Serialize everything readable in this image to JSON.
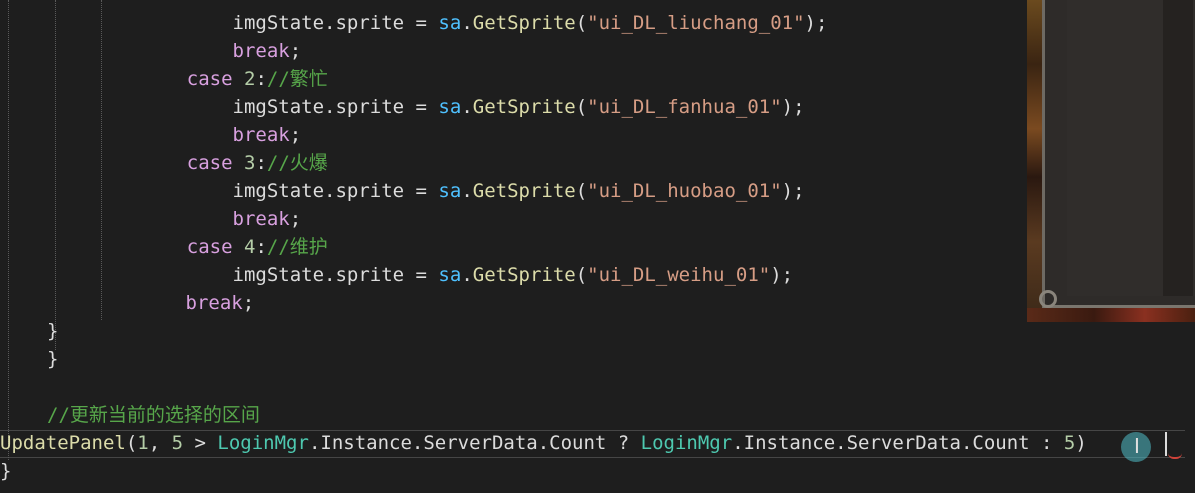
{
  "colors": {
    "background": "#1e1e1e",
    "keyword": "#569cd6",
    "control_keyword": "#d8a0df",
    "number": "#b5cea8",
    "string": "#d69d85",
    "comment": "#57a64a",
    "class_name": "#4ec9b0",
    "method": "#dcdcaa",
    "variable": "#9cdcfe",
    "plain": "#dcdcdc"
  },
  "icons": {
    "cursor": "cursor-ibeam-icon",
    "caret": "caret-icon",
    "error_squiggle": "squiggle-icon"
  },
  "code": {
    "lines": [
      {
        "tokens": [
          {
            "text": "        imgState",
            "type": "pln"
          },
          {
            "text": ".sprite = ",
            "type": "pln"
          },
          {
            "text": "sa",
            "type": "sa"
          },
          {
            "text": ".",
            "type": "pln"
          },
          {
            "text": "GetSprite",
            "type": "mtd"
          },
          {
            "text": "(",
            "type": "pln"
          },
          {
            "text": "\"ui_DL_liuchang_01\"",
            "type": "str"
          },
          {
            "text": ");",
            "type": "pln"
          }
        ]
      },
      {
        "tokens": [
          {
            "text": "        ",
            "type": "pln"
          },
          {
            "text": "break",
            "type": "ctl"
          },
          {
            "text": ";",
            "type": "pln"
          }
        ]
      },
      {
        "tokens": [
          {
            "text": "    ",
            "type": "pln"
          },
          {
            "text": "case",
            "type": "ctl"
          },
          {
            "text": " ",
            "type": "pln"
          },
          {
            "text": "2",
            "type": "num"
          },
          {
            "text": ":",
            "type": "pln"
          },
          {
            "text": "//繁忙",
            "type": "cmt"
          }
        ]
      },
      {
        "tokens": [
          {
            "text": "        imgState",
            "type": "pln"
          },
          {
            "text": ".sprite = ",
            "type": "pln"
          },
          {
            "text": "sa",
            "type": "sa"
          },
          {
            "text": ".",
            "type": "pln"
          },
          {
            "text": "GetSprite",
            "type": "mtd"
          },
          {
            "text": "(",
            "type": "pln"
          },
          {
            "text": "\"ui_DL_fanhua_01\"",
            "type": "str"
          },
          {
            "text": ");",
            "type": "pln"
          }
        ]
      },
      {
        "tokens": [
          {
            "text": "        ",
            "type": "pln"
          },
          {
            "text": "break",
            "type": "ctl"
          },
          {
            "text": ";",
            "type": "pln"
          }
        ]
      },
      {
        "tokens": [
          {
            "text": "    ",
            "type": "pln"
          },
          {
            "text": "case",
            "type": "ctl"
          },
          {
            "text": " ",
            "type": "pln"
          },
          {
            "text": "3",
            "type": "num"
          },
          {
            "text": ":",
            "type": "pln"
          },
          {
            "text": "//火爆",
            "type": "cmt"
          }
        ]
      },
      {
        "tokens": [
          {
            "text": "        imgState",
            "type": "pln"
          },
          {
            "text": ".sprite = ",
            "type": "pln"
          },
          {
            "text": "sa",
            "type": "sa"
          },
          {
            "text": ".",
            "type": "pln"
          },
          {
            "text": "GetSprite",
            "type": "mtd"
          },
          {
            "text": "(",
            "type": "pln"
          },
          {
            "text": "\"ui_DL_huobao_01\"",
            "type": "str"
          },
          {
            "text": ");",
            "type": "pln"
          }
        ]
      },
      {
        "tokens": [
          {
            "text": "        ",
            "type": "pln"
          },
          {
            "text": "break",
            "type": "ctl"
          },
          {
            "text": ";",
            "type": "pln"
          }
        ]
      },
      {
        "tokens": [
          {
            "text": "    ",
            "type": "pln"
          },
          {
            "text": "case",
            "type": "ctl"
          },
          {
            "text": " ",
            "type": "pln"
          },
          {
            "text": "4",
            "type": "num"
          },
          {
            "text": ":",
            "type": "pln"
          },
          {
            "text": "//维护",
            "type": "cmt"
          }
        ]
      },
      {
        "tokens": [
          {
            "text": "        imgState",
            "type": "pln"
          },
          {
            "text": ".sprite = ",
            "type": "pln"
          },
          {
            "text": "sa",
            "type": "sa"
          },
          {
            "text": ".",
            "type": "pln"
          },
          {
            "text": "GetSprite",
            "type": "mtd"
          },
          {
            "text": "(",
            "type": "pln"
          },
          {
            "text": "\"ui_DL_weihu_01\"",
            "type": "str"
          },
          {
            "text": ");",
            "type": "pln"
          }
        ]
      },
      {
        "tokens": [
          {
            "text": "        ",
            "type": "pln"
          },
          {
            "text": "break",
            "type": "ctl"
          },
          {
            "text": ";",
            "type": "pln"
          }
        ]
      },
      {
        "tokens": [
          {
            "text": "}",
            "type": "pln"
          }
        ]
      },
      {
        "tokens": [
          {
            "text": "}",
            "type": "pln"
          }
        ]
      },
      {
        "tokens": []
      },
      {
        "tokens": [
          {
            "text": "//更新当前的选择的区间",
            "type": "cmt"
          }
        ]
      },
      {
        "tokens": [
          {
            "text": "UpdatePanel",
            "type": "mtd"
          },
          {
            "text": "(",
            "type": "pln"
          },
          {
            "text": "1",
            "type": "num"
          },
          {
            "text": ", ",
            "type": "pln"
          },
          {
            "text": "5",
            "type": "num"
          },
          {
            "text": " > ",
            "type": "pln"
          },
          {
            "text": "LoginMgr",
            "type": "cls"
          },
          {
            "text": ".Instance.ServerData.Count ? ",
            "type": "pln"
          },
          {
            "text": "LoginMgr",
            "type": "cls"
          },
          {
            "text": ".Instance.ServerData.Count : ",
            "type": "pln"
          },
          {
            "text": "5",
            "type": "num"
          },
          {
            "text": ")",
            "type": "pln"
          }
        ]
      },
      {
        "tokens": [
          {
            "text": "}",
            "type": "pln"
          }
        ]
      }
    ]
  }
}
